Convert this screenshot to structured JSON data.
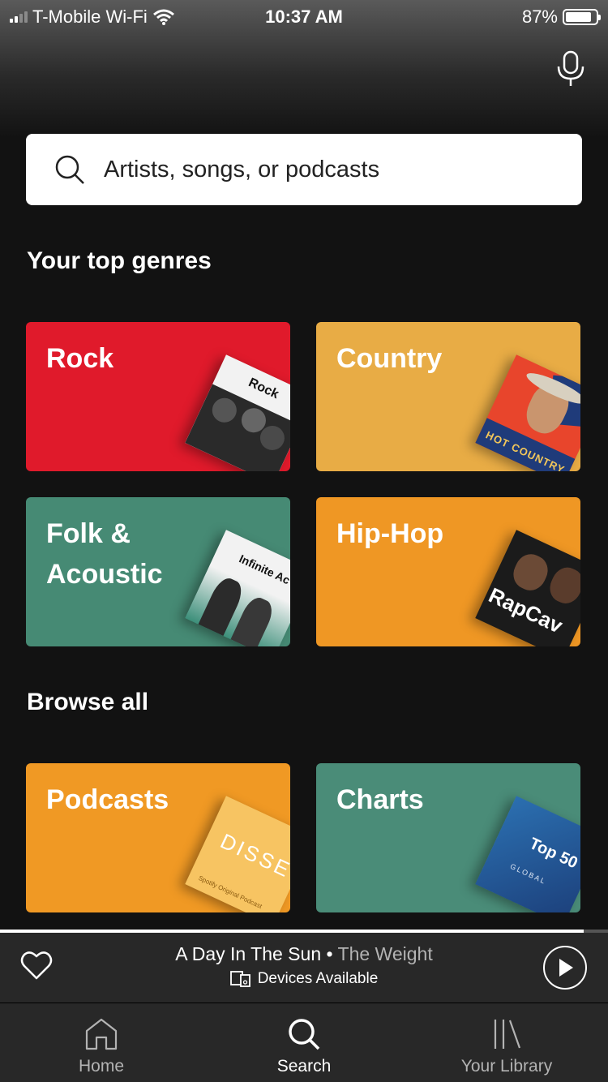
{
  "status_bar": {
    "carrier": "T-Mobile Wi-Fi",
    "time": "10:37 AM",
    "battery": "87%",
    "battery_level": 0.87
  },
  "search": {
    "placeholder": "Artists, songs, or podcasts"
  },
  "sections": {
    "top_genres_title": "Your top genres",
    "browse_all_title": "Browse all"
  },
  "genres": [
    {
      "label": "Rock",
      "color": "#e01a2b",
      "art_text": "Rock"
    },
    {
      "label": "Country",
      "color": "#e8ac45",
      "art_text": "HOT COUNTRY"
    },
    {
      "label": "Folk & Acoustic",
      "color": "#468a74",
      "art_text": "Infinite Ac"
    },
    {
      "label": "Hip-Hop",
      "color": "#ef9724",
      "art_text": "RapCav"
    }
  ],
  "browse": [
    {
      "label": "Podcasts",
      "color": "#f09924",
      "art_text": "DISSEC",
      "art_subtext": "Spotify Original Podcast"
    },
    {
      "label": "Charts",
      "color": "#4a8c78",
      "art_text": "Top 50",
      "art_subtext": "GLOBAL"
    }
  ],
  "now_playing": {
    "title": "A Day In The Sun",
    "separator": " • ",
    "artist": "The Weight",
    "devices": "Devices Available",
    "progress": 0.96
  },
  "tabs": [
    {
      "label": "Home",
      "icon": "home-icon"
    },
    {
      "label": "Search",
      "icon": "search-icon",
      "active": true
    },
    {
      "label": "Your Library",
      "icon": "library-icon"
    }
  ],
  "colors": {
    "accent": "#ffffff",
    "background": "#121212",
    "bar": "#282828"
  }
}
